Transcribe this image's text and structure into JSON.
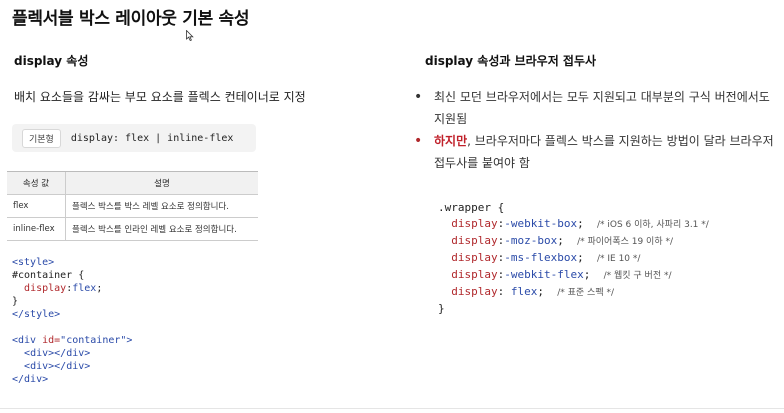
{
  "title": "플렉서블 박스 레이아웃 기본 속성",
  "left": {
    "heading": "display 속성",
    "description": "배치 요소들을 감싸는 부모 요소를 플렉스 컨테이너로 지정",
    "syntax_tag": "기본형",
    "syntax_code": "display: flex | inline-flex",
    "table": {
      "headers": [
        "속성 값",
        "설명"
      ],
      "rows": [
        {
          "value": "flex",
          "desc": "플렉스 박스를 박스 레벨 요소로 정의합니다."
        },
        {
          "value": "inline-flex",
          "desc": "플렉스 박스를 인라인 레벨 요소로 정의합니다."
        }
      ]
    },
    "css_code": {
      "style_open": "<style>",
      "selector": "#container {",
      "prop": "display",
      "val": "flex",
      "close_brace": "}",
      "style_close": "</style>"
    },
    "html_code": {
      "div_open_tag": "<div ",
      "id_attr": "id=",
      "id_value": "\"container\"",
      "div_open_end": ">",
      "child1": "<div></div>",
      "child2": "<div></div>",
      "div_close": "</div>"
    }
  },
  "right": {
    "heading": "display 속성과 브라우저 접두사",
    "bullet1": "최신 모던 브라우저에서는 모두 지원되고 대부분의 구식 버전에서도 지원됨",
    "bullet2_highlight": "하지만",
    "bullet2_rest": ", 브라우저마다 플렉스 박스를 지원하는 방법이 달라 브라우저 접두사를 붙여야 함",
    "code": {
      "selector": ".wrapper {",
      "lines": [
        {
          "prop": "display",
          "val": "-webkit-box",
          "comment": "/* iOS 6 이하, 사파리 3.1 */"
        },
        {
          "prop": "display",
          "val": "-moz-box",
          "comment": "/* 파이어폭스 19 이하 */"
        },
        {
          "prop": "display",
          "val": "-ms-flexbox",
          "comment": "/* IE 10 */"
        },
        {
          "prop": "display",
          "val": "-webkit-flex",
          "comment": "/* 웹킷 구 버전 */"
        },
        {
          "prop": "display",
          "val": " flex",
          "comment": "/* 표준 스펙 */"
        }
      ],
      "close": "}"
    }
  }
}
